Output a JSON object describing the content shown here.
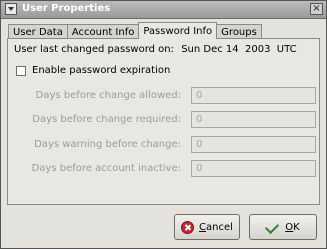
{
  "window": {
    "title": "User Properties",
    "close_glyph": "×"
  },
  "tabs": [
    {
      "label": "User Data",
      "active": false
    },
    {
      "label": "Account Info",
      "active": false
    },
    {
      "label": "Password Info",
      "active": true
    },
    {
      "label": "Groups",
      "active": false
    }
  ],
  "password_info": {
    "last_changed_label": "User last changed password on:",
    "last_changed_value": "Sun Dec 14  2003  UTC",
    "expiration_checkbox": {
      "label": "Enable password expiration",
      "checked": false
    },
    "fields": [
      {
        "label": "Days before change allowed:",
        "value": "0"
      },
      {
        "label": "Days before change required:",
        "value": "0"
      },
      {
        "label": "Days warning before change:",
        "value": "0"
      },
      {
        "label": "Days before account inactive:",
        "value": "0"
      }
    ]
  },
  "buttons": {
    "cancel": {
      "label": "Cancel",
      "mnemonic": "C",
      "rest": "ancel",
      "icon": "cancel-icon"
    },
    "ok": {
      "label": "OK",
      "mnemonic": "O",
      "rest": "K",
      "icon": "checkmark-icon"
    }
  },
  "colors": {
    "titlebar": "#9a9a9a",
    "panel": "#e9e7e2",
    "disabled_text": "#9d9b96",
    "cancel_icon": "#c02b2b",
    "ok_icon": "#2a8a2a"
  }
}
